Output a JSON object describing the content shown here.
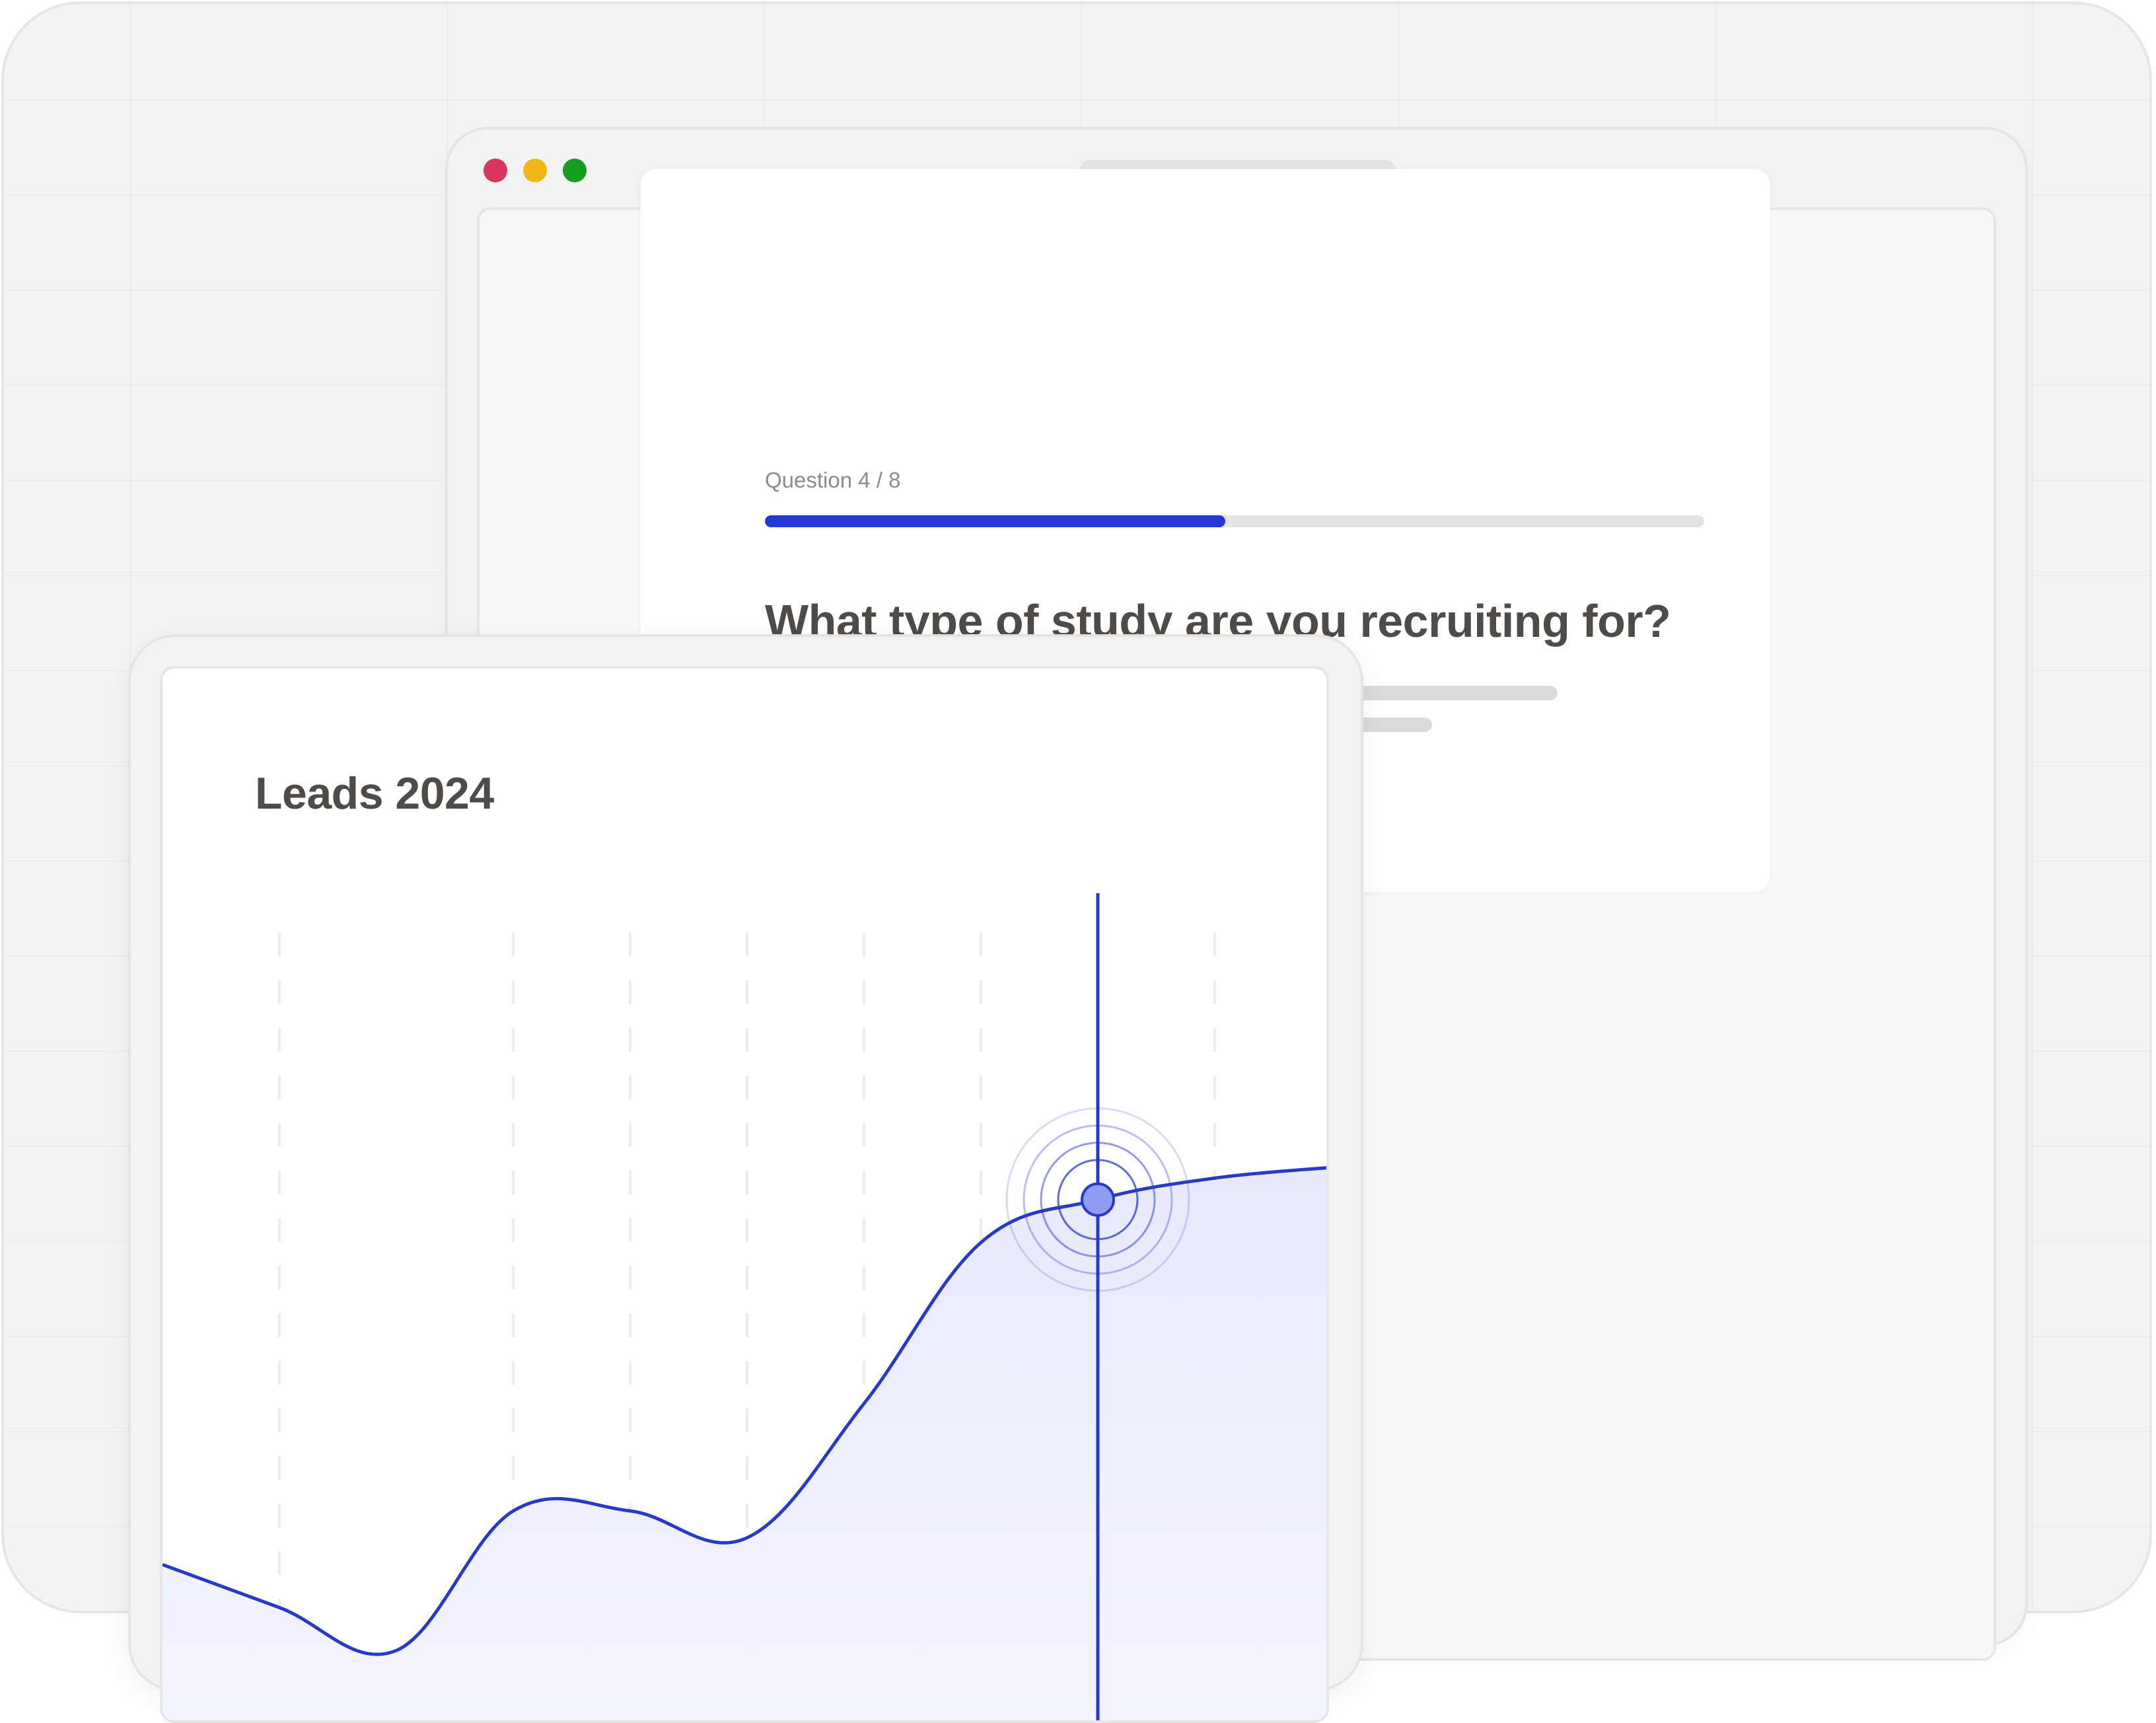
{
  "browser": {
    "traffic_lights": {
      "close_color": "#d9365e",
      "minimize_color": "#efb817",
      "maximize_color": "#159d23"
    }
  },
  "survey": {
    "question_counter": "Question 4 / 8",
    "progress": 0.49,
    "question": "What type of study are you recruiting for?",
    "accent_color": "#2439d4"
  },
  "chart_data": {
    "type": "area",
    "title": "Leads 2024",
    "xlabel": "",
    "ylabel": "",
    "grid": "vertical-dashed",
    "x": [
      0,
      1,
      2,
      3,
      4,
      5,
      6,
      7,
      8,
      9,
      10
    ],
    "values": [
      30,
      22,
      14,
      40,
      40,
      35,
      60,
      90,
      98,
      102,
      104
    ],
    "ylim": [
      0,
      160
    ],
    "highlight_index": 8,
    "line_color": "#2839c8",
    "fill_color": "#e8eafc"
  }
}
